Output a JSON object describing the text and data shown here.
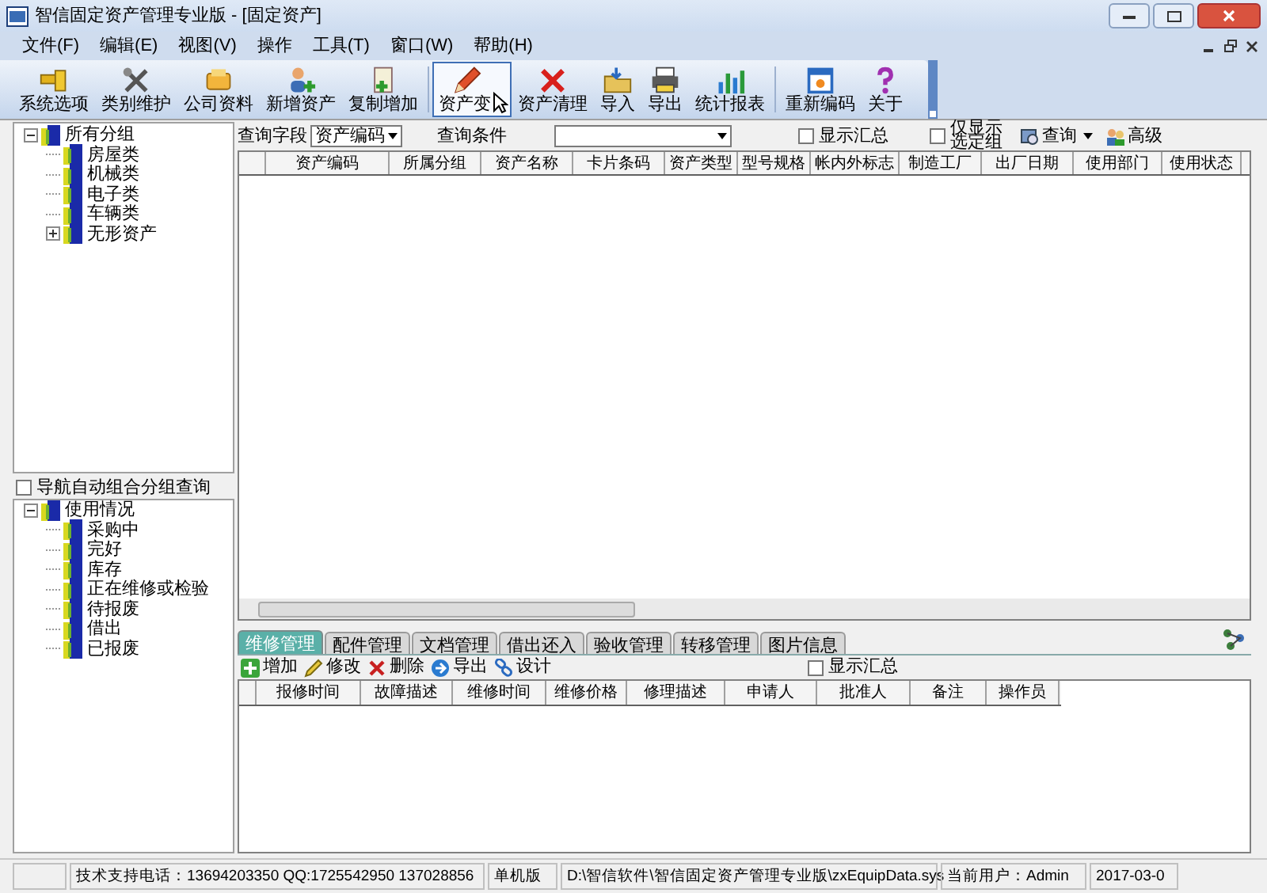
{
  "window": {
    "title": "智信固定资产管理专业版 - [固定资产]"
  },
  "menu": [
    "文件(F)",
    "编辑(E)",
    "视图(V)",
    "操作",
    "工具(T)",
    "窗口(W)",
    "帮助(H)"
  ],
  "toolbar_groups": [
    [
      {
        "label": "系统选项",
        "pressed": false
      },
      {
        "label": "类别维护",
        "pressed": false
      },
      {
        "label": "公司资料",
        "pressed": false
      },
      {
        "label": "新增资产",
        "pressed": false
      },
      {
        "label": "复制增加",
        "pressed": false
      }
    ],
    [
      {
        "label": "资产变",
        "pressed": true
      },
      {
        "label": "资产清理",
        "pressed": false
      },
      {
        "label": "导入",
        "pressed": false
      },
      {
        "label": "导出",
        "pressed": false
      },
      {
        "label": "统计报表",
        "pressed": false
      }
    ],
    [
      {
        "label": "重新编码",
        "pressed": false
      },
      {
        "label": "关于",
        "pressed": false
      }
    ]
  ],
  "group_tree": [
    {
      "label": "所有分组",
      "expanded": true,
      "children": [
        {
          "label": "房屋类"
        },
        {
          "label": "机械类"
        },
        {
          "label": "电子类"
        },
        {
          "label": "车辆类"
        },
        {
          "label": "无形资产",
          "expanded": false
        }
      ]
    }
  ],
  "nav_option": {
    "label": "导航自动组合分组查询",
    "checked": false
  },
  "status_tree": [
    {
      "label": "使用情况",
      "expanded": true,
      "children": [
        {
          "label": "采购中"
        },
        {
          "label": "完好"
        },
        {
          "label": "库存"
        },
        {
          "label": "正在维修或检验"
        },
        {
          "label": "待报废"
        },
        {
          "label": "借出"
        },
        {
          "label": "已报废"
        }
      ]
    }
  ],
  "query": {
    "field_label": "查询字段",
    "field_value": "资产编码",
    "condition_label": "查询条件",
    "show_summary": {
      "label": "显示汇总",
      "checked": false
    },
    "only_selected": {
      "label": "仅显示选定组",
      "checked": false
    },
    "search_button": "查询",
    "advanced_button": "高级"
  },
  "grid": {
    "columns": [
      "资产编码",
      "所属分组",
      "资产名称",
      "卡片条码",
      "资产类型",
      "型号规格",
      "帐内外标志",
      "制造工厂",
      "出厂日期",
      "使用部门",
      "使用状态"
    ]
  },
  "tabs": [
    {
      "label": "维修管理",
      "selected": true
    },
    {
      "label": "配件管理",
      "selected": false
    },
    {
      "label": "文档管理",
      "selected": false
    },
    {
      "label": "借出还入",
      "selected": false
    },
    {
      "label": "验收管理",
      "selected": false
    },
    {
      "label": "转移管理",
      "selected": false
    },
    {
      "label": "图片信息",
      "selected": false
    }
  ],
  "sub_toolbar": [
    "增加",
    "修改",
    "删除",
    "导出",
    "设计"
  ],
  "sub_summary": {
    "label": "显示汇总",
    "checked": false
  },
  "sub_grid": {
    "columns": [
      "报修时间",
      "故障描述",
      "维修时间",
      "维修价格",
      "修理描述",
      "申请人",
      "批准人",
      "备注",
      "操作员"
    ]
  },
  "status_bar": [
    "技术支持电话：13694203350 QQ:1725542950 137028856",
    "单机版",
    "D:\\智信软件\\智信固定资产管理专业版\\zxEquipData.sys",
    "当前用户：Admin",
    "2017-03-0"
  ]
}
